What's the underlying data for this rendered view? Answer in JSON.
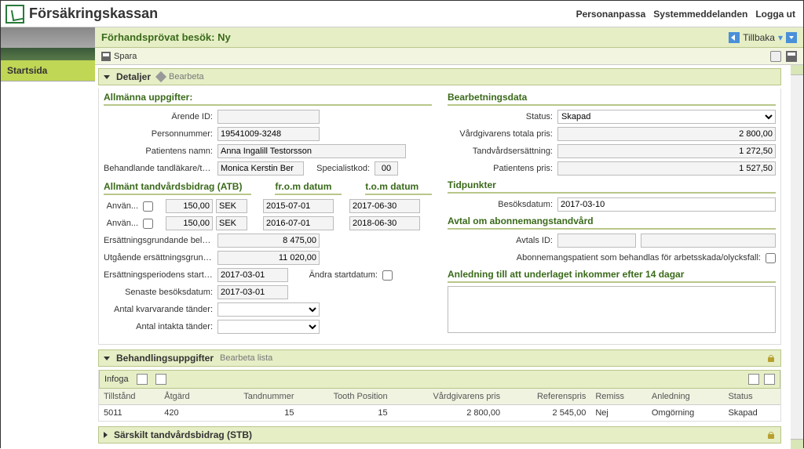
{
  "brand": "Försäkringskassan",
  "header_links": {
    "personalize": "Personanpassa",
    "system": "Systemmeddelanden",
    "logout": "Logga ut"
  },
  "sidebar": {
    "start": "Startsida"
  },
  "pagebar": {
    "title": "Förhandsprövat besök: Ny",
    "back": "Tillbaka"
  },
  "toolbar": {
    "save": "Spara"
  },
  "details": {
    "title": "Detaljer",
    "edit": "Bearbeta",
    "general_title": "Allmänna uppgifter:",
    "labels": {
      "arende_id": "Ärende ID:",
      "personnummer": "Personnummer:",
      "patient_name": "Patientens namn:",
      "dentist": "Behandlande tandläkare/tan...",
      "specialist": "Specialistkod:",
      "anvand": "Använ...",
      "ers_belopp": "Ersättningsgrundande belopp:",
      "utgaende": "Utgående ersättningsgrunda...",
      "ers_start": "Ersättningsperiodens startda...",
      "andra_start": "Ändra startdatum:",
      "senaste": "Senaste besöksdatum:",
      "antal_kvar": "Antal kvarvarande tänder:",
      "antal_intakta": "Antal intakta tänder:"
    },
    "values": {
      "personnummer": "19541009-3248",
      "patient_name": "Anna Ingalill Testorsson",
      "dentist": "Monica Kerstin Ber",
      "specialist": "00",
      "atb1_amt": "150,00",
      "atb1_cur": "SEK",
      "atb1_from": "2015-07-01",
      "atb1_to": "2017-06-30",
      "atb2_amt": "150,00",
      "atb2_cur": "SEK",
      "atb2_from": "2016-07-01",
      "atb2_to": "2018-06-30",
      "ers_belopp": "8 475,00",
      "utgaende": "11 020,00",
      "ers_start": "2017-03-01",
      "senaste": "2017-03-01"
    },
    "atb_title": "Allmänt tandvårdsbidrag (ATB)",
    "atb_from": "fr.o.m datum",
    "atb_to": "t.o.m datum",
    "processing_title": "Bearbetningsdata",
    "proc_labels": {
      "status": "Status:",
      "total_price": "Vårdgivarens totala pris:",
      "reimb": "Tandvårdsersättning:",
      "patient_price": "Patientens pris:"
    },
    "proc_values": {
      "status": "Skapad",
      "total_price": "2 800,00",
      "reimb": "1 272,50",
      "patient_price": "1 527,50"
    },
    "timepoints_title": "Tidpunkter",
    "time_labels": {
      "besok": "Besöksdatum:"
    },
    "time_values": {
      "besok": "2017-03-10"
    },
    "agreement_title": "Avtal om abonnemangstandvård",
    "agreement_labels": {
      "avtal_id": "Avtals ID:",
      "abonn": "Abonnemangspatient som behandlas för arbetsskada/olycksfall:"
    },
    "reason_title": "Anledning till att underlaget inkommer efter 14 dagar"
  },
  "treatment": {
    "title": "Behandlingsuppgifter",
    "edit": "Bearbeta lista",
    "insert": "Infoga",
    "cols": {
      "tillstand": "Tillstånd",
      "atgard": "Åtgärd",
      "tandnr": "Tandnummer",
      "toothpos": "Tooth Position",
      "price": "Vårdgivarens pris",
      "refprice": "Referenspris",
      "remiss": "Remiss",
      "anledning": "Anledning",
      "status": "Status"
    },
    "rows": [
      {
        "tillstand": "5011",
        "atgard": "420",
        "tandnr": "15",
        "toothpos": "15",
        "price": "2 800,00",
        "refprice": "2 545,00",
        "remiss": "Nej",
        "anledning": "Omgörning",
        "status": "Skapad"
      }
    ]
  },
  "stb": {
    "title": "Särskilt tandvårdsbidrag (STB)"
  }
}
